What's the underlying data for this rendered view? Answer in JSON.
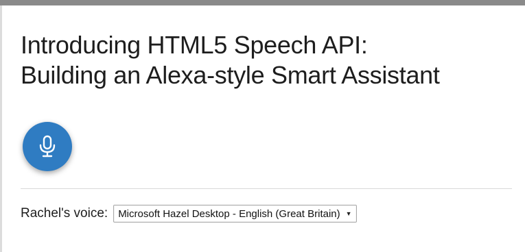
{
  "page": {
    "title_line1": "Introducing HTML5 Speech API:",
    "title_line2": "Building an Alexa-style Smart Assistant"
  },
  "mic": {
    "icon": "microphone-icon",
    "color": "#2f7cc2"
  },
  "voice": {
    "label": "Rachel's voice:",
    "selected": "Microsoft Hazel Desktop - English (Great Britain)",
    "arrow": "▼"
  }
}
